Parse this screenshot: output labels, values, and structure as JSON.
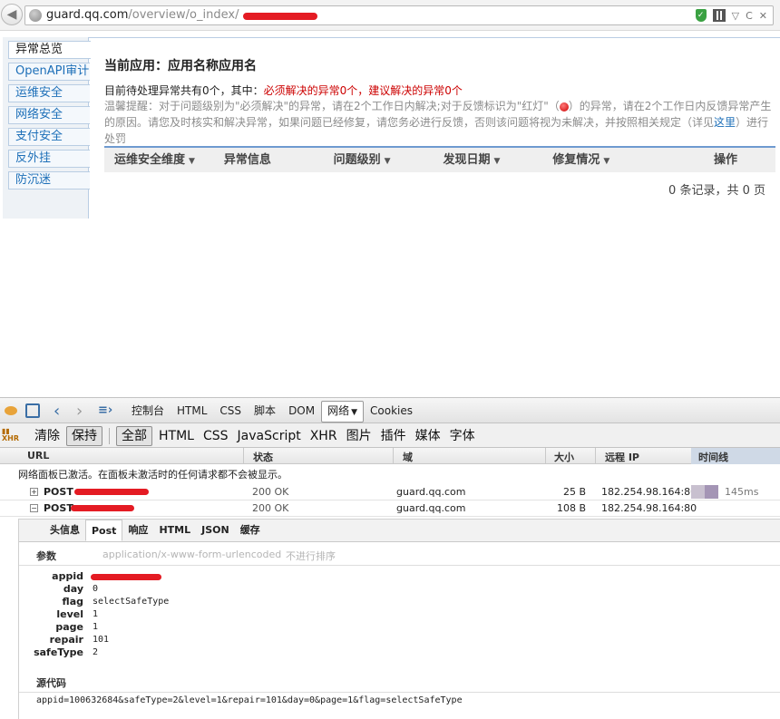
{
  "browser": {
    "url_host": "guard.qq.com",
    "url_path": "/overview/o_index/"
  },
  "sidebar": {
    "items": [
      {
        "label": "异常总览"
      },
      {
        "label": "OpenAPI审计"
      },
      {
        "label": "运维安全"
      },
      {
        "label": "网络安全"
      },
      {
        "label": "支付安全"
      },
      {
        "label": "反外挂"
      },
      {
        "label": "防沉迷"
      }
    ]
  },
  "main": {
    "title": "当前应用：应用名称应用名",
    "pending_prefix": "目前待处理异常共有0个，其中：",
    "pending_red": "必须解决的异常0个，建议解决的异常0个",
    "tip_text_1": "温馨提醒：对于问题级别为\"必须解决\"的异常，请在2个工作日内解决;对于反馈标识为\"红灯\"（",
    "tip_text_2": "）的异常，请在2个工作日内反馈异常产生的原因。请您及时核实和解决异常，如果问题已经修复，请您务必进行反馈，否则该问题将视为未解决，并按照相关规定（详见",
    "tip_link": "这里",
    "tip_text_3": "）进行处罚",
    "columns": [
      "运维安全维度",
      "异常信息",
      "问题级别",
      "发现日期",
      "修复情况",
      "操作"
    ],
    "pager": "0 条记录，共 0 页"
  },
  "firebug": {
    "tabs": [
      "控制台",
      "HTML",
      "CSS",
      "脚本",
      "DOM",
      "网络",
      "Cookies"
    ],
    "toolbar": [
      "清除",
      "保持",
      "全部",
      "HTML",
      "CSS",
      "JavaScript",
      "XHR",
      "图片",
      "插件",
      "媒体",
      "字体"
    ],
    "net_columns": {
      "url": "URL",
      "status": "状态",
      "domain": "域",
      "size": "大小",
      "remote": "远程 IP",
      "timeline": "时间线"
    },
    "notice": "网络面板已激活。在面板未激活时的任何请求都不会被显示。",
    "requests": [
      {
        "method": "POST",
        "status": "200 OK",
        "domain": "guard.qq.com",
        "size": "25 B",
        "remote": "182.254.98.164:80",
        "time": "145ms"
      },
      {
        "method": "POST",
        "status": "200 OK",
        "domain": "guard.qq.com",
        "size": "108 B",
        "remote": "182.254.98.164:80",
        "time": ""
      }
    ],
    "detail_tabs": [
      "头信息",
      "Post",
      "响应",
      "HTML",
      "JSON",
      "缓存"
    ],
    "params_header": "参数",
    "content_type": "application/x-www-form-urlencoded",
    "sort_label": "不进行排序",
    "params": [
      {
        "key": "appid",
        "value": ""
      },
      {
        "key": "day",
        "value": "0"
      },
      {
        "key": "flag",
        "value": "selectSafeType"
      },
      {
        "key": "level",
        "value": "1"
      },
      {
        "key": "page",
        "value": "1"
      },
      {
        "key": "repair",
        "value": "101"
      },
      {
        "key": "safeType",
        "value": "2"
      }
    ],
    "source_header": "源代码",
    "source": "appid=100632684&safeType=2&level=1&repair=101&day=0&page=1&flag=selectSafeType"
  }
}
